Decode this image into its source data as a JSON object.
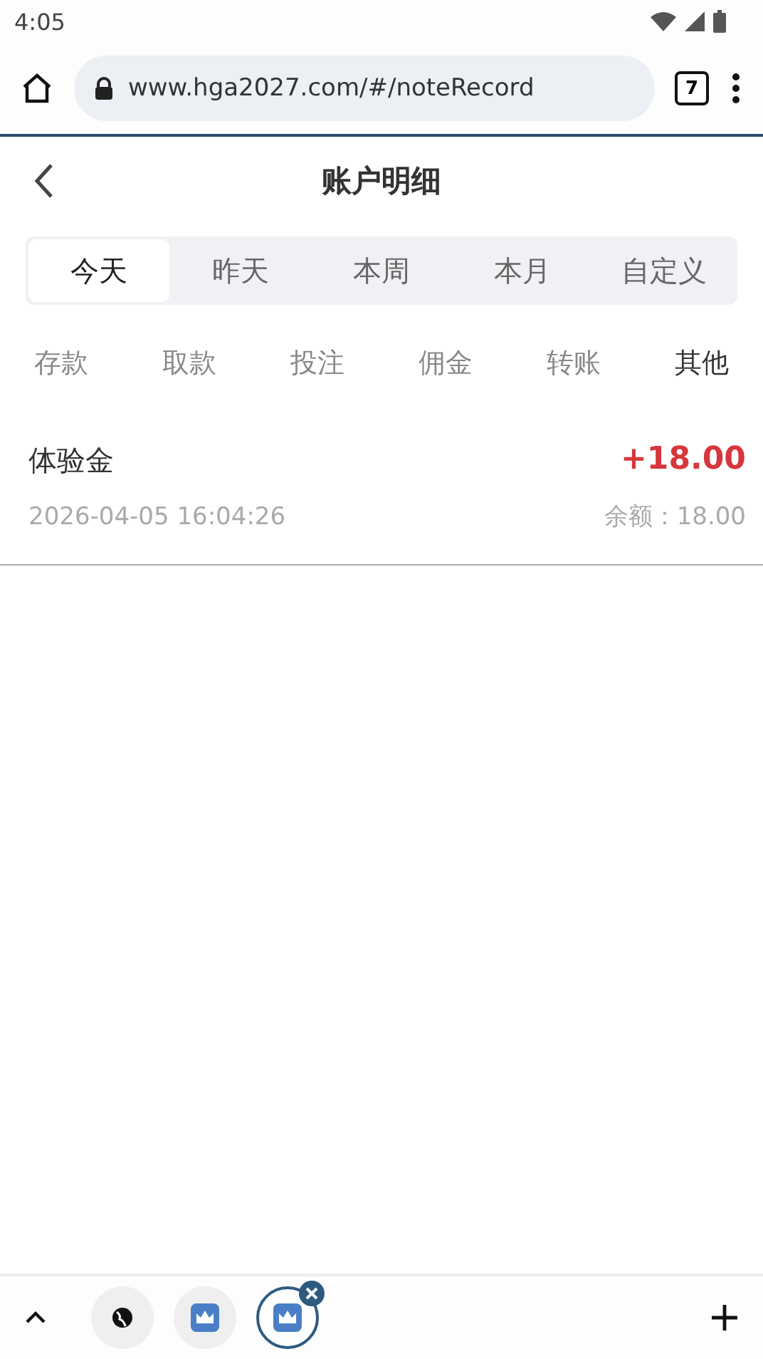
{
  "status_bar": {
    "time": "4:05"
  },
  "browser": {
    "url": "www.hga2027.com/#/noteRecord",
    "tab_count": "7"
  },
  "header": {
    "title": "账户明细"
  },
  "period_tabs": [
    {
      "label": "今天",
      "selected": true
    },
    {
      "label": "昨天",
      "selected": false
    },
    {
      "label": "本周",
      "selected": false
    },
    {
      "label": "本月",
      "selected": false
    },
    {
      "label": "自定义",
      "selected": false
    }
  ],
  "type_tabs": [
    {
      "label": "存款",
      "selected": false
    },
    {
      "label": "取款",
      "selected": false
    },
    {
      "label": "投注",
      "selected": false
    },
    {
      "label": "佣金",
      "selected": false
    },
    {
      "label": "转账",
      "selected": false
    },
    {
      "label": "其他",
      "selected": true
    }
  ],
  "records": [
    {
      "name": "体验金",
      "time": "2026-04-05 16:04:26",
      "amount": "+18.00",
      "balance": "余额：18.00"
    }
  ],
  "tab_strip": [
    {
      "kind": "globe",
      "selected": false
    },
    {
      "kind": "crown",
      "selected": false
    },
    {
      "kind": "crown",
      "selected": true
    }
  ]
}
